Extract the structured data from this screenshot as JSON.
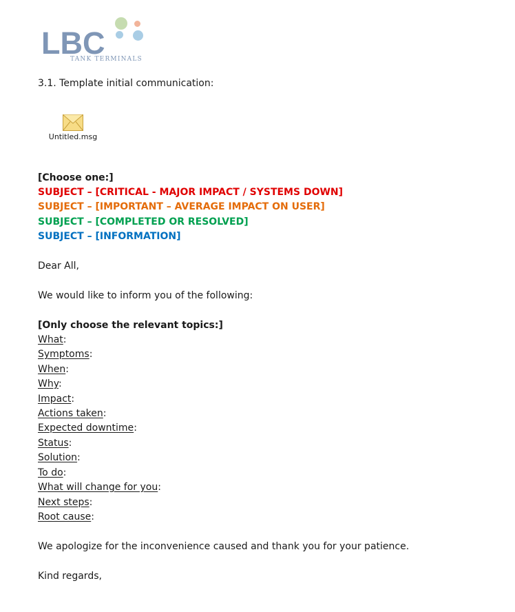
{
  "logo": {
    "text": "LBC",
    "subtitle": "TANK TERMINALS"
  },
  "heading": "3.1. Template initial communication:",
  "attachment": {
    "icon": "envelope-icon",
    "filename": "Untitled.msg"
  },
  "choose_one": "[Choose one:]",
  "subjects": [
    {
      "text": "SUBJECT – [CRITICAL - MAJOR IMPACT / SYSTEMS DOWN]",
      "color": "#e00000"
    },
    {
      "text": "SUBJECT – [IMPORTANT – AVERAGE IMPACT ON USER]",
      "color": "#e46c0a"
    },
    {
      "text": "SUBJECT – [COMPLETED OR RESOLVED]",
      "color": "#00a050"
    },
    {
      "text": "SUBJECT – [INFORMATION]",
      "color": "#0070c0"
    }
  ],
  "greeting": "Dear All,",
  "intro": "We would like to inform you of the following:",
  "topics_heading": "[Only choose the relevant topics:]",
  "topics": [
    "What",
    "Symptoms",
    "When",
    "Why",
    "Impact",
    "Actions taken",
    "Expected downtime",
    "Status",
    "Solution",
    "To do",
    "What will change for you",
    "Next steps",
    "Root cause"
  ],
  "colon": ":",
  "apology": "We apologize for the inconvenience caused and thank you for your patience.",
  "closing": "Kind regards,"
}
